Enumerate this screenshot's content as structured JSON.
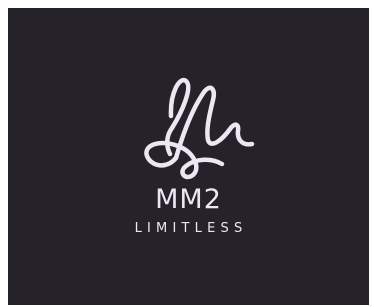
{
  "brand": {
    "name": "MM2",
    "tagline": "LIMITLESS"
  },
  "colors": {
    "background": "#252329",
    "outer_border": "#ffffff",
    "logo": "#ebe8f3"
  },
  "icons": {
    "logo_mark": "script-m-monogram"
  }
}
